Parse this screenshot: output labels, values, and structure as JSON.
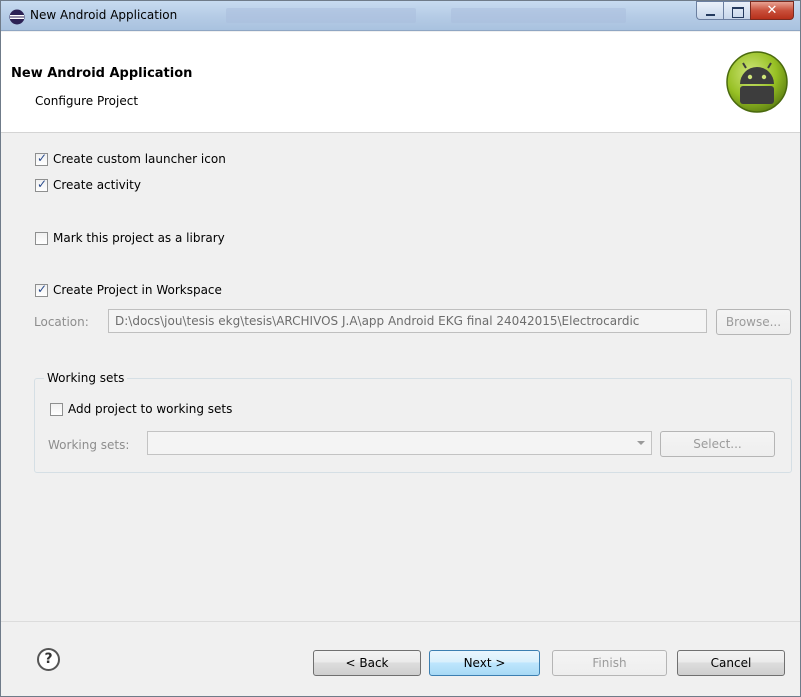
{
  "window": {
    "title": "New Android Application"
  },
  "header": {
    "title": "New Android Application",
    "subtitle": "Configure Project"
  },
  "options": {
    "custom_launcher_icon": {
      "label": "Create custom launcher icon",
      "checked": true
    },
    "create_activity": {
      "label": "Create activity",
      "checked": true
    },
    "mark_library": {
      "label": "Mark this project as a library",
      "checked": false
    },
    "create_in_workspace": {
      "label": "Create Project in Workspace",
      "checked": true
    }
  },
  "location": {
    "label": "Location:",
    "value": "D:\\docs\\jou\\tesis ekg\\tesis\\ARCHIVOS J.A\\app Android EKG final 24042015\\Electrocardic",
    "browse_label": "Browse..."
  },
  "working_sets": {
    "group_title": "Working sets",
    "add_label": "Add project to working sets",
    "add_checked": false,
    "field_label": "Working sets:",
    "field_value": "",
    "select_label": "Select..."
  },
  "footer": {
    "help_glyph": "?",
    "back_label": "< Back",
    "next_label": "Next >",
    "finish_label": "Finish",
    "cancel_label": "Cancel"
  },
  "colors": {
    "android_green": "#97c024",
    "titlebar": "#b6cce6",
    "close_button": "#c9503b"
  }
}
